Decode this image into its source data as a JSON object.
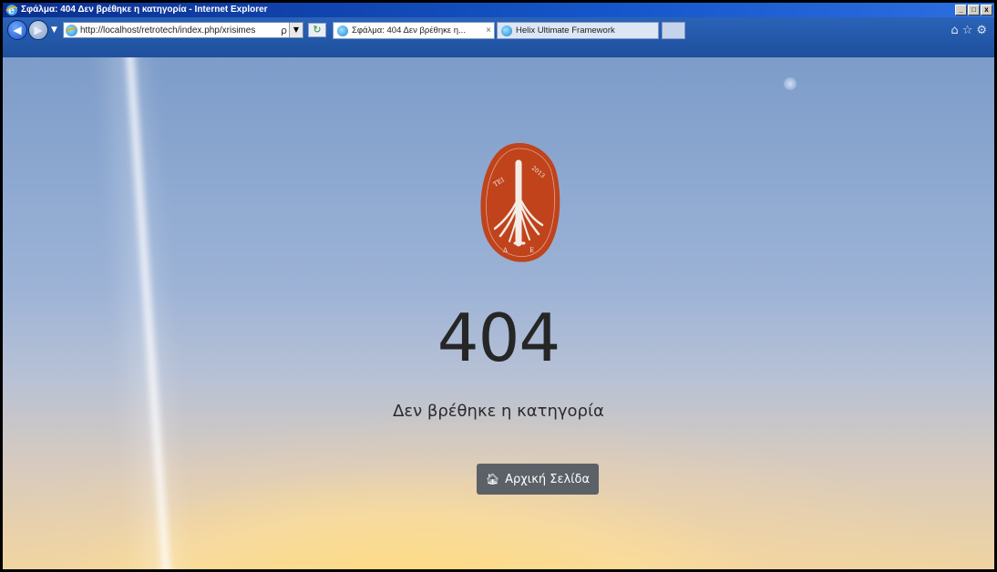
{
  "window": {
    "title": "Σφάλμα: 404 Δεν βρέθηκε η κατηγορία - Internet Explorer",
    "controls": [
      "_",
      "□",
      "x"
    ]
  },
  "toolbar": {
    "address_host": "http://localhost",
    "address_path": "/retrotech/index.php/xrisimes",
    "search_glyph": "ρ",
    "refresh_glyph": "↻"
  },
  "tabs": [
    {
      "label": "Σφάλμα: 404 Δεν βρέθηκε η...",
      "close": "×",
      "active": true
    },
    {
      "label": "Helix Ultimate Framework",
      "active": false
    }
  ],
  "toolbar_right_icons": [
    "home-icon",
    "star-icon",
    "gear-icon"
  ],
  "page": {
    "logo_text": [
      "ΤΕΙ",
      "2013",
      "Δ",
      "Ε"
    ],
    "error_code": "404",
    "error_message": "Δεν βρέθηκε η κατηγορία",
    "home_button_label": "Αρχική Σελίδα",
    "home_button_icon": "home-icon"
  },
  "colors": {
    "logo_red": "#c0431c",
    "button_bg": "#5c6167",
    "text_dark": "#262626"
  }
}
